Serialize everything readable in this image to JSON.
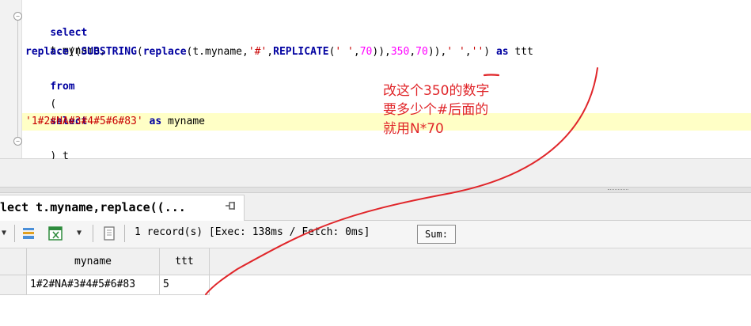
{
  "editor": {
    "lines": [
      {
        "kw": "select"
      },
      {
        "text": "t.myname,"
      },
      {
        "parts": [
          "replace",
          "((",
          "SUBSTRING",
          "(",
          "replace",
          "(t.myname,",
          "'#'",
          ",",
          "REPLICATE",
          "(",
          "' '",
          ",",
          "70",
          ")),",
          "350",
          ",",
          "70",
          ")),",
          "' '",
          ",",
          "''",
          ") ",
          "as",
          " ttt"
        ]
      },
      {
        "kw": "from"
      },
      {
        "text": "("
      },
      {
        "kw": "select"
      },
      {
        "str": "'1#2#NA#3#4#5#6#83'",
        "rest_kw": "as",
        "rest": " myname"
      },
      {
        "text": ") t"
      }
    ]
  },
  "annotation": {
    "lines": [
      "改这个350的数字",
      "要多少个#后面的",
      "就用N*70"
    ],
    "color": "#e0262a"
  },
  "result_tab": {
    "label": "lect t.myname,replace((...",
    "pin_icon": "pin-icon"
  },
  "toolbar": {
    "status": "1 record(s) [Exec: 138ms / Fetch: 0ms]",
    "sum_label": "Sum:"
  },
  "grid": {
    "columns": [
      "myname",
      "ttt"
    ],
    "rows": [
      [
        "1#2#NA#3#4#5#6#83",
        "5"
      ]
    ]
  },
  "colors": {
    "keyword": "#0000a0",
    "string": "#c80000",
    "number": "#ff00ff",
    "highlight_line": "#ffffc6",
    "annotation": "#e0262a"
  }
}
